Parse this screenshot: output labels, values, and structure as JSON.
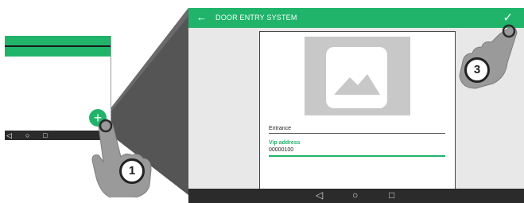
{
  "left_phone": {
    "fab_symbol": "+",
    "nav": {
      "back": "◁",
      "home": "○",
      "recent": "□"
    }
  },
  "screen": {
    "header": {
      "back_icon": "←",
      "title": "DOOR ENTRY SYSTEM",
      "confirm_icon": "✓"
    },
    "form": {
      "entrance_value": "Entrance",
      "vip_label": "Vip address",
      "vip_value": "00000100"
    },
    "nav": {
      "back": "◁",
      "home": "○",
      "recent": "□"
    }
  },
  "steps": {
    "step1": "1",
    "step3": "3"
  },
  "colors": {
    "accent": "#1fb46a",
    "dark": "#2b2b2b",
    "wedge": "#555555"
  }
}
